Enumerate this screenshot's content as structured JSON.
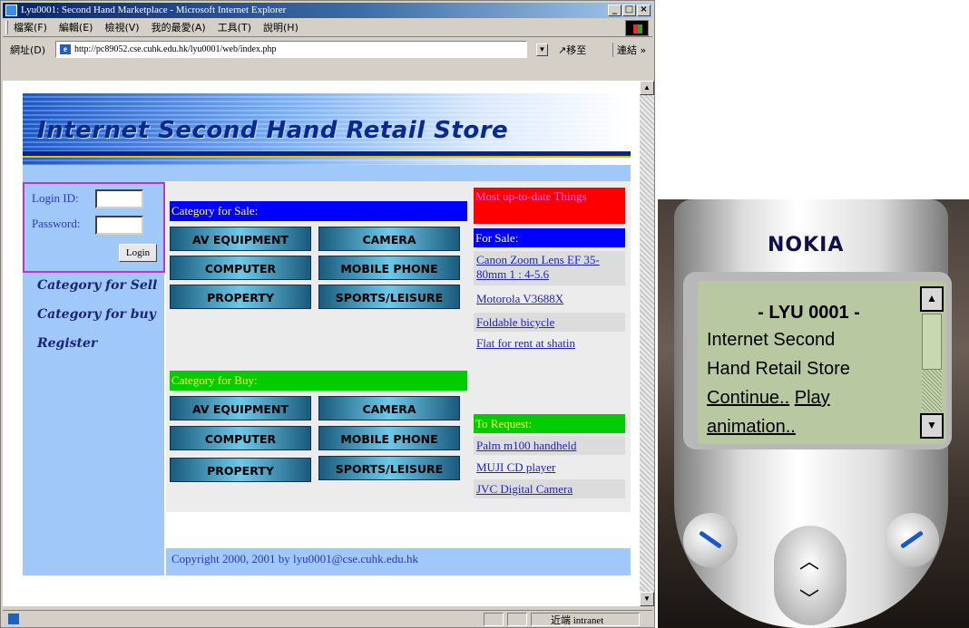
{
  "window": {
    "title": "Lyu0001: Second Hand Marketplace - Microsoft Internet Explorer",
    "menu": [
      "檔案(F)",
      "編輯(E)",
      "檢視(V)",
      "我的最愛(A)",
      "工具(T)",
      "說明(H)"
    ],
    "address_label": "網址(D)",
    "url": "http://pc89052.cse.cuhk.edu.hk/lyu0001/web/index.php",
    "go_label": "移至",
    "links_label": "連結 »",
    "zone": "近端 intranet"
  },
  "page": {
    "banner_title": "Internet Second Hand Retail Store",
    "login": {
      "id_label": "Login ID:",
      "password_label": "Password:",
      "button": "Login"
    },
    "side_links": [
      "Category for Sell",
      "Category for buy",
      "Register"
    ],
    "sale": {
      "heading": "Category for Sale:",
      "buttons": [
        "AV EQUIPMENT",
        "CAMERA",
        "COMPUTER",
        "MOBILE PHONE",
        "PROPERTY",
        "SPORTS/LEISURE"
      ]
    },
    "buy": {
      "heading": "Category for Buy:",
      "buttons": [
        "AV EQUIPMENT",
        "CAMERA",
        "COMPUTER",
        "MOBILE PHONE",
        "PROPERTY",
        "SPORTS/LEISURE"
      ]
    },
    "right": {
      "latest_heading": "Most up-to-date Things",
      "for_sale_heading": "For Sale:",
      "for_sale_items": [
        "Canon Zoom Lens EF 35-80mm 1 : 4-5.6",
        "Motorola V3688X",
        "Foldable bicycle",
        "Flat for rent at shatin"
      ],
      "request_heading": "To Request:",
      "request_items": [
        "Palm m100 handheld",
        "MUJI CD player",
        "JVC Digital Camera"
      ]
    },
    "footer": "Copyright 2000, 2001 by lyu0001@cse.cuhk.edu.hk"
  },
  "phone": {
    "brand": "NOKIA",
    "screen": {
      "title": "- LYU 0001 -",
      "line1": "Internet Second",
      "line2": "Hand Retail Store",
      "link1": "Continue..",
      "link2": "Play",
      "link3": "animation.."
    }
  },
  "colors": {
    "sale_heading_bg": "#0000ff",
    "buy_heading_bg": "#00cc00",
    "latest_heading_bg": "#ff0000",
    "page_panel": "#a0c8f8"
  }
}
